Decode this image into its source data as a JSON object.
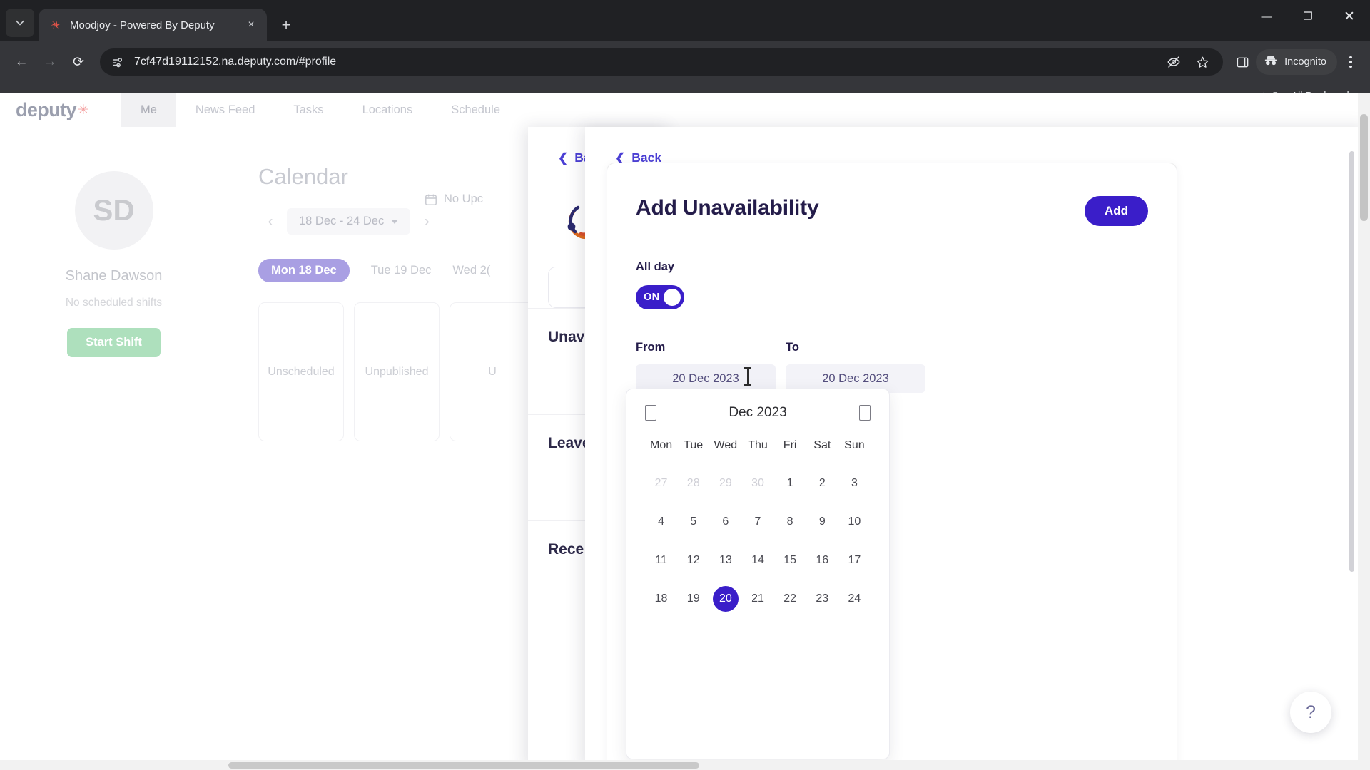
{
  "browser": {
    "tab": {
      "title": "Moodjoy - Powered By Deputy",
      "favicon": "moodjoy-icon",
      "close": "×"
    },
    "newtab_label": "+",
    "tabsearch_icon": "chevron-down-icon",
    "window": {
      "minimize": "—",
      "maximize": "❐",
      "close": "✕"
    },
    "nav": {
      "back": "←",
      "forward": "→",
      "reload": "⟳"
    },
    "omnibox": {
      "url": "7cf47d19112152.na.deputy.com/#profile",
      "site_icon": "page-info-icon"
    },
    "toolbar_icons": {
      "eye_off": "eye-off-icon",
      "bookmark": "star-icon",
      "side_panel": "side-panel-icon",
      "menu": "kebab-menu-icon"
    },
    "incognito": {
      "label": "Incognito",
      "icon": "incognito-icon"
    },
    "bookmarks": {
      "separator": "|",
      "all_bookmarks": "All Bookmarks",
      "folder_icon": "folder-icon"
    }
  },
  "app": {
    "logo": {
      "text": "deputy",
      "star": "✳"
    },
    "nav_items": [
      {
        "label": "Me",
        "active": true
      },
      {
        "label": "News Feed",
        "active": false
      },
      {
        "label": "Tasks",
        "active": false
      },
      {
        "label": "Locations",
        "active": false
      },
      {
        "label": "Schedule",
        "active": false
      }
    ]
  },
  "profile": {
    "initials": "SD",
    "name": "Shane Dawson",
    "shift_status": "No scheduled shifts",
    "start_shift_label": "Start Shift"
  },
  "calendar": {
    "title": "Calendar",
    "prev_arrow": "‹",
    "next_arrow": "›",
    "range": "18 Dec - 24 Dec",
    "no_upcoming": "No Upc",
    "no_upcoming_icon": "calendar-icon",
    "day_tabs": [
      {
        "label": "Mon 18 Dec",
        "active": true
      },
      {
        "label": "Tue 19 Dec",
        "active": false
      },
      {
        "label": "Wed 2(",
        "active": false
      }
    ],
    "cards": [
      "Unscheduled",
      "Unpublished",
      "U"
    ]
  },
  "panel1": {
    "back_label": "Bac",
    "logo_name": "moodjoy-logo",
    "sections": [
      "Unav",
      "Leave",
      "Rece"
    ]
  },
  "panel2": {
    "back_label": "Back"
  },
  "modal": {
    "title": "Add Unavailability",
    "add_button": "Add",
    "all_day_label": "All day",
    "toggle_state": "ON",
    "from_label": "From",
    "from_value": "20 Dec 2023",
    "to_label": "To",
    "to_value": "20 Dec 2023"
  },
  "datepicker": {
    "prev_icon": "prev-month-icon",
    "next_icon": "next-month-icon",
    "month_label": "Dec 2023",
    "weekdays": [
      "Mon",
      "Tue",
      "Wed",
      "Thu",
      "Fri",
      "Sat",
      "Sun"
    ],
    "days": [
      {
        "d": "27",
        "muted": true
      },
      {
        "d": "28",
        "muted": true
      },
      {
        "d": "29",
        "muted": true
      },
      {
        "d": "30",
        "muted": true
      },
      {
        "d": "1"
      },
      {
        "d": "2"
      },
      {
        "d": "3"
      },
      {
        "d": "4"
      },
      {
        "d": "5"
      },
      {
        "d": "6"
      },
      {
        "d": "7"
      },
      {
        "d": "8"
      },
      {
        "d": "9"
      },
      {
        "d": "10"
      },
      {
        "d": "11"
      },
      {
        "d": "12"
      },
      {
        "d": "13"
      },
      {
        "d": "14"
      },
      {
        "d": "15"
      },
      {
        "d": "16"
      },
      {
        "d": "17"
      },
      {
        "d": "18"
      },
      {
        "d": "19"
      },
      {
        "d": "20",
        "selected": true
      },
      {
        "d": "21"
      },
      {
        "d": "22"
      },
      {
        "d": "23"
      },
      {
        "d": "24"
      }
    ]
  },
  "help": {
    "label": "?"
  },
  "colors": {
    "accent_indigo": "#3a1ec9",
    "back_link": "#4b3fd4",
    "day_tab_active": "#a99fe3",
    "start_shift_green": "#aee0bd",
    "modal_title": "#241c4a"
  }
}
